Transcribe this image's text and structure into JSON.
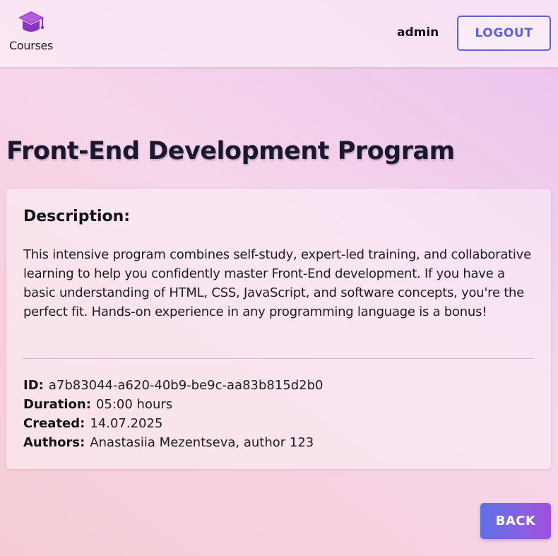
{
  "header": {
    "logo_text": "Courses",
    "logo_icon": "graduation-cap-icon",
    "username": "admin",
    "logout_label": "LOGOUT"
  },
  "course": {
    "title": "Front-End Development Program",
    "description_heading": "Description:",
    "description": "This intensive program combines self-study, expert-led training, and collaborative learning to help you confidently master Front-End development. If you have a basic understanding of HTML, CSS, JavaScript, and software concepts, you're the perfect fit. Hands-on experience in any programming language is a bonus!",
    "details": {
      "id_label": "ID:",
      "id_value": "a7b83044-a620-40b9-be9c-aa83b815d2b0",
      "duration_label": "Duration:",
      "duration_value": "05:00 hours",
      "created_label": "Created:",
      "created_value": "14.07.2025",
      "authors_label": "Authors:",
      "authors_value": "Anastasiia Mezentseva, author 123"
    }
  },
  "actions": {
    "back_label": "BACK"
  },
  "colors": {
    "accent": "#5d62d4",
    "logo_purple": "#9b3fd1",
    "back_gradient_start": "#5d70e6",
    "back_gradient_end": "#a050dc"
  }
}
